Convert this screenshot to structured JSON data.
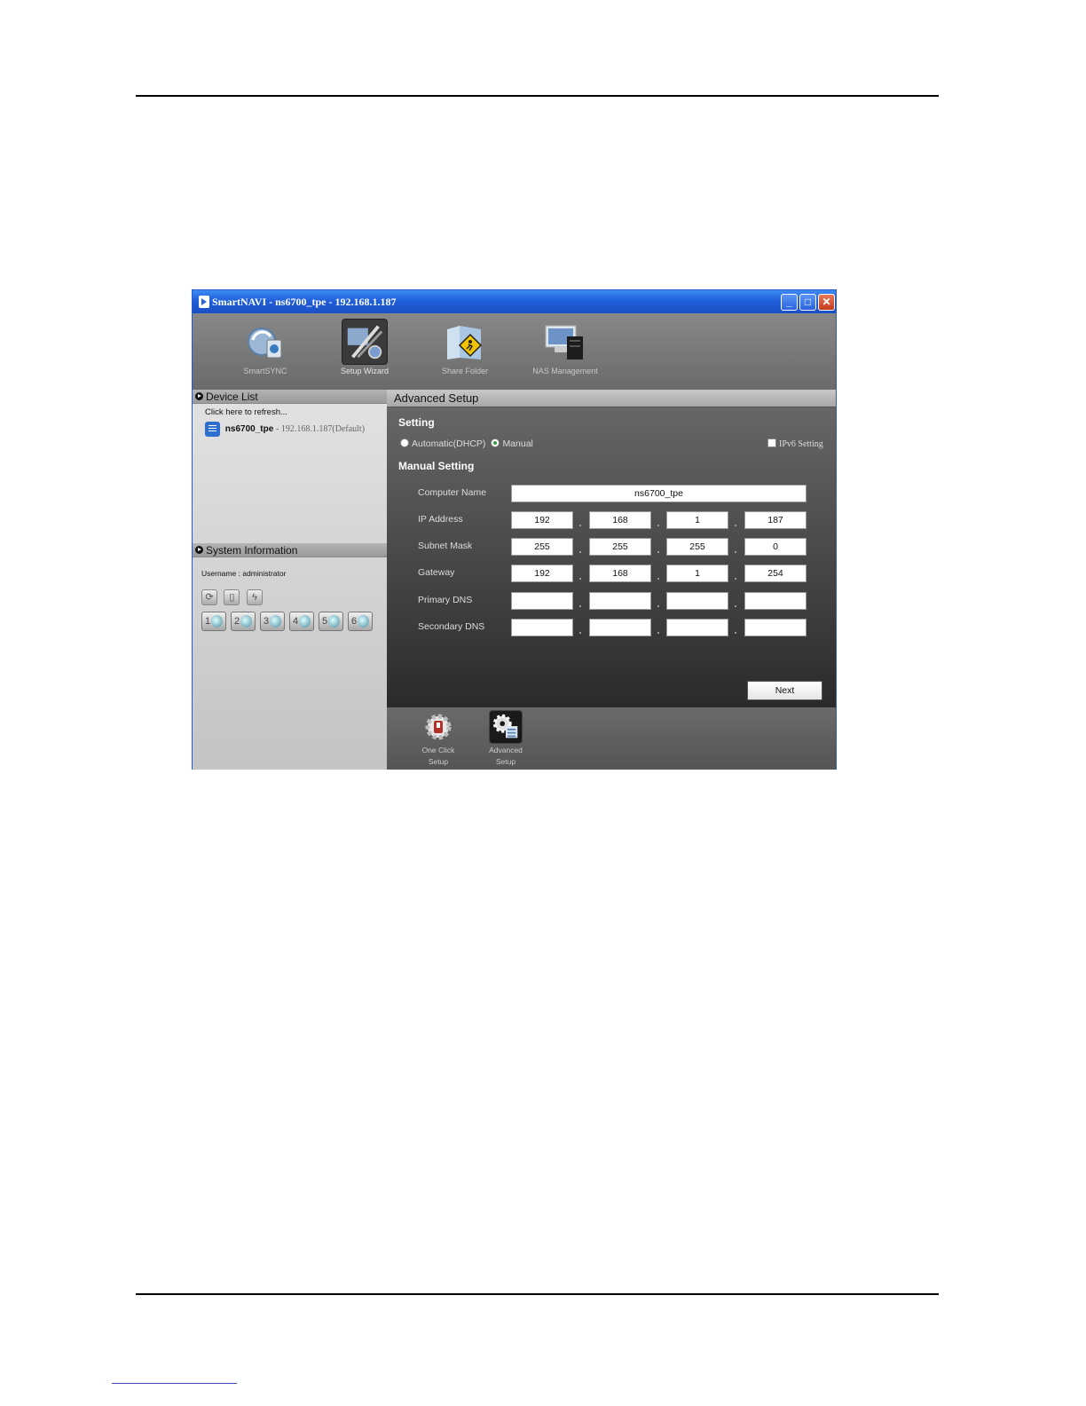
{
  "window": {
    "title": "SmartNAVI - ns6700_tpe - 192.168.1.187",
    "min_glyph": "_",
    "max_glyph": "□",
    "close_glyph": "✕"
  },
  "toolbar": {
    "items": [
      {
        "label": "SmartSYNC",
        "icon": "smartsync-icon"
      },
      {
        "label": "Setup Wizard",
        "icon": "setup-wizard-icon",
        "selected": true
      },
      {
        "label": "Share Folder",
        "icon": "share-folder-icon"
      },
      {
        "label": "NAS Management",
        "icon": "nas-management-icon"
      }
    ]
  },
  "device_list": {
    "heading": "Device List",
    "refresh_text": "Click here to refresh...",
    "device_name": "ns6700_tpe",
    "device_detail": " - 192.168.1.187(Default)"
  },
  "system_info": {
    "heading": "System Information",
    "username_text": "Username : administrator",
    "disks": [
      "1",
      "2",
      "3",
      "4",
      "5",
      "6"
    ]
  },
  "main": {
    "heading": "Advanced Setup",
    "setting_heading": "Setting",
    "radio_dhcp": "Automatic(DHCP)",
    "radio_manual": "Manual",
    "selected_mode": "Manual",
    "ipv6_label": "IPv6 Setting",
    "ipv6_checked": false,
    "manual_heading": "Manual Setting",
    "computer_name_label": "Computer Name",
    "computer_name_value": "ns6700_tpe",
    "ip_label": "IP Address",
    "ip": [
      "192",
      "168",
      "1",
      "187"
    ],
    "subnet_label": "Subnet Mask",
    "subnet": [
      "255",
      "255",
      "255",
      "0"
    ],
    "gateway_label": "Gateway",
    "gateway": [
      "192",
      "168",
      "1",
      "254"
    ],
    "dns1_label": "Primary DNS",
    "dns1": [
      "",
      "",
      "",
      ""
    ],
    "dns2_label": "Secondary DNS",
    "dns2": [
      "",
      "",
      "",
      ""
    ],
    "next_label": "Next"
  },
  "bottom": {
    "one_click_label_1": "One Click",
    "one_click_label_2": "Setup",
    "advanced_label_1": "Advanced",
    "advanced_label_2": "Setup"
  },
  "colors": {
    "titlebar": "#1f5fd9",
    "radio_selected": "#3a9a3a"
  }
}
